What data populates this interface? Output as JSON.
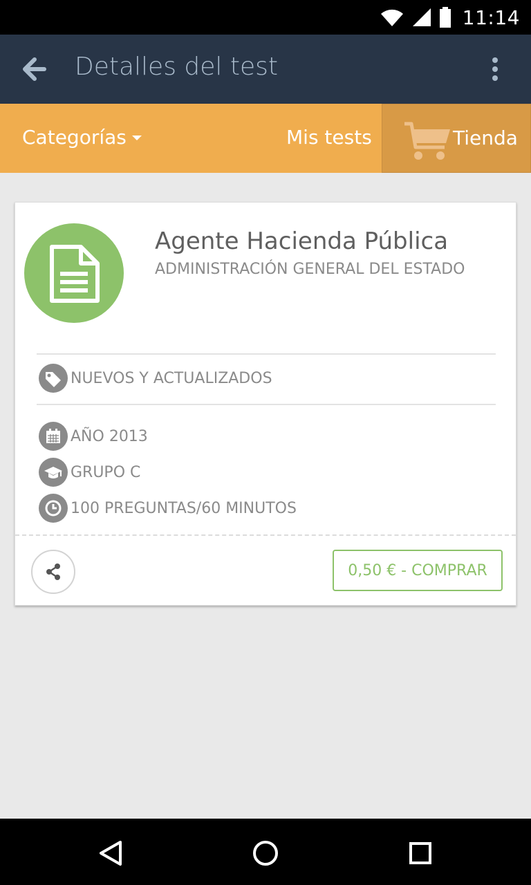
{
  "status_bar": {
    "time": "11:14"
  },
  "app_bar": {
    "title": "Detalles del test"
  },
  "tabs": {
    "categories": "Categorías",
    "my_tests": "Mis tests",
    "store": "Tienda"
  },
  "test": {
    "title": "Agente Hacienda Pública",
    "organization": "ADMINISTRACIÓN GENERAL DEL ESTADO",
    "tag": "NUEVOS Y ACTUALIZADOS",
    "details": [
      "AÑO 2013",
      "GRUPO C",
      "100 PREGUNTAS/60 MINUTOS"
    ]
  },
  "actions": {
    "buy_label": "0,50 € - COMPRAR"
  },
  "colors": {
    "app_bar": "#283547",
    "tab_bar": "#f0ad4e",
    "accent_green": "#8dc26a"
  },
  "icons": {
    "status": [
      "wifi-icon",
      "signal-icon",
      "battery-icon"
    ],
    "app_bar": [
      "back-arrow-icon",
      "overflow-menu-icon"
    ],
    "tab": [
      "chevron-down-icon",
      "cart-icon"
    ],
    "card": [
      "document-icon",
      "tag-icon",
      "calendar-icon",
      "graduation-cap-icon",
      "clock-icon",
      "share-icon"
    ],
    "nav": [
      "back-triangle-icon",
      "home-circle-icon",
      "recents-square-icon"
    ]
  }
}
